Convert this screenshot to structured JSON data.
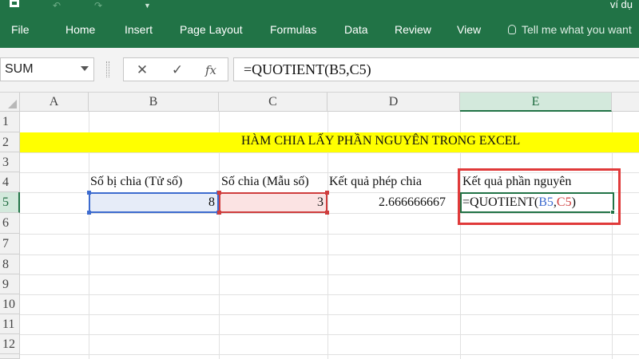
{
  "window": {
    "title": "ví dụ"
  },
  "ribbon": {
    "tabs": [
      {
        "label": "File"
      },
      {
        "label": "Home"
      },
      {
        "label": "Insert"
      },
      {
        "label": "Page Layout"
      },
      {
        "label": "Formulas"
      },
      {
        "label": "Data"
      },
      {
        "label": "Review"
      },
      {
        "label": "View"
      }
    ],
    "tell_me": "Tell me what you want"
  },
  "formula_bar": {
    "name_box": "SUM",
    "cancel_icon": "✕",
    "enter_icon": "✓",
    "fx_icon": "fx",
    "formula": "=QUOTIENT(B5,C5)"
  },
  "sheet": {
    "columns": [
      "A",
      "B",
      "C",
      "D",
      "E"
    ],
    "active_column": "E",
    "rows": [
      "1",
      "2",
      "3",
      "4",
      "5",
      "6",
      "7",
      "8",
      "9",
      "10",
      "11",
      "12"
    ],
    "active_row": "5",
    "banner": "HÀM CHIA LẤY PHẦN NGUYÊN TRONG EXCEL",
    "headers": {
      "b4": "Số bị chia (Tử số)",
      "c4": "Số chia (Mẫu số)",
      "d4": "Kết quả phép chia",
      "e4": "Kết quả phần nguyên"
    },
    "values": {
      "b5": "8",
      "c5": "3",
      "d5": "2.666666667"
    },
    "editing": {
      "e5_prefix": "=QUOTIENT(",
      "e5_ref1": "B5",
      "e5_comma": ",",
      "e5_ref2": "C5",
      "e5_suffix": ")"
    },
    "colors": {
      "ribbon": "#217346",
      "banner": "#ffff00",
      "ref_b": "#3d6bcf",
      "ref_c": "#cf3d3d",
      "highlight": "#e03a3a"
    }
  }
}
